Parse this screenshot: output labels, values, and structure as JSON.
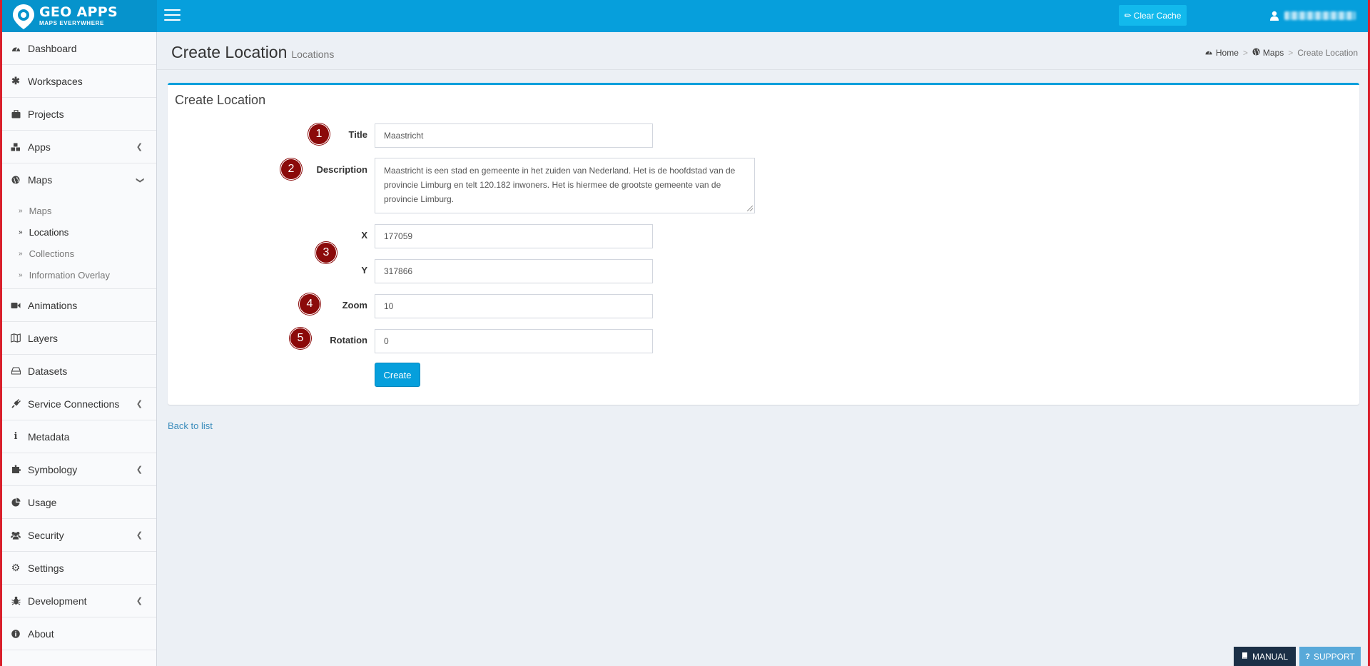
{
  "brand": {
    "title": "GEO APPS",
    "subtitle": "MAPS EVERYWHERE"
  },
  "header": {
    "clear_cache_label": "Clear Cache"
  },
  "sidebar": {
    "items": [
      {
        "label": "Dashboard",
        "icon": "dashboard-icon"
      },
      {
        "label": "Workspaces",
        "icon": "asterisk-icon"
      },
      {
        "label": "Projects",
        "icon": "suitcase-icon"
      },
      {
        "label": "Apps",
        "icon": "cubes-icon",
        "has_children": true
      },
      {
        "label": "Maps",
        "icon": "globe-icon",
        "expanded": true
      },
      {
        "label": "Animations",
        "icon": "video-camera-icon"
      },
      {
        "label": "Layers",
        "icon": "map-icon"
      },
      {
        "label": "Datasets",
        "icon": "hdd-icon"
      },
      {
        "label": "Service Connections",
        "icon": "plug-icon",
        "has_children": true
      },
      {
        "label": "Metadata",
        "icon": "info-icon"
      },
      {
        "label": "Symbology",
        "icon": "puzzle-icon",
        "has_children": true
      },
      {
        "label": "Usage",
        "icon": "pie-chart-icon"
      },
      {
        "label": "Security",
        "icon": "users-icon",
        "has_children": true
      },
      {
        "label": "Settings",
        "icon": "gear-icon"
      },
      {
        "label": "Development",
        "icon": "bug-icon",
        "has_children": true
      },
      {
        "label": "About",
        "icon": "info-circle-icon"
      }
    ],
    "maps_submenu": [
      {
        "label": "Maps",
        "active": false
      },
      {
        "label": "Locations",
        "active": true
      },
      {
        "label": "Collections",
        "active": false
      },
      {
        "label": "Information Overlay",
        "active": false
      }
    ]
  },
  "page": {
    "title": "Create Location",
    "subtitle": "Locations"
  },
  "breadcrumb": {
    "home": "Home",
    "maps": "Maps",
    "current": "Create Location"
  },
  "form": {
    "box_title": "Create Location",
    "title_label": "Title",
    "title_value": "Maastricht",
    "description_label": "Description",
    "description_value": "Maastricht is een stad en gemeente in het zuiden van Nederland. Het is de hoofdstad van de provincie Limburg en telt 120.182 inwoners. Het is hiermee de grootste gemeente van de provincie Limburg.",
    "x_label": "X",
    "x_value": "177059",
    "y_label": "Y",
    "y_value": "317866",
    "zoom_label": "Zoom",
    "zoom_value": "10",
    "rotation_label": "Rotation",
    "rotation_value": "0",
    "create_label": "Create"
  },
  "markers": [
    "1",
    "2",
    "3",
    "4",
    "5"
  ],
  "back_link": "Back to list",
  "footer": {
    "manual_label": "MANUAL",
    "support_label": "SUPPORT"
  },
  "colors": {
    "header": "#069fdc",
    "marker": "#8b0a0a",
    "manual": "#1b2f46",
    "support": "#58a9d9"
  }
}
